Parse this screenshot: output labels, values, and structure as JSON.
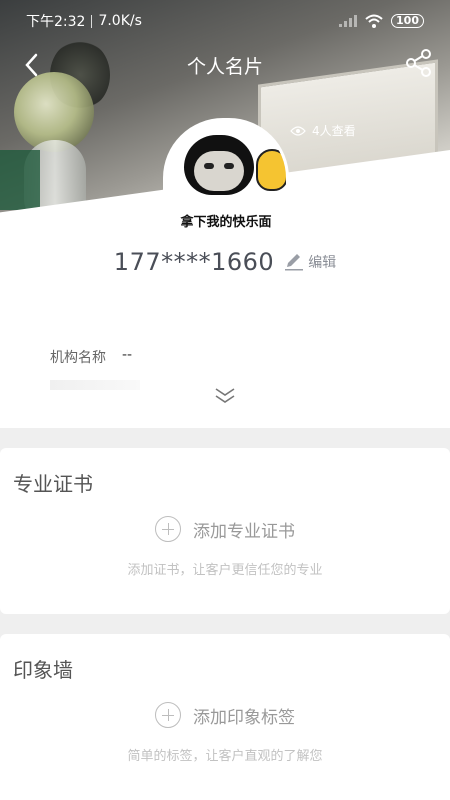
{
  "status_bar": {
    "time": "下午2:32",
    "speed": "7.0K/s",
    "battery": "100"
  },
  "nav": {
    "title": "个人名片"
  },
  "profile": {
    "views": "4人查看",
    "avatar_caption": "拿下我的快乐面",
    "phone": "177****1660",
    "edit_label": "编辑",
    "org_label": "机构名称",
    "org_value": "--"
  },
  "certificates": {
    "title": "专业证书",
    "add_label": "添加专业证书",
    "hint": "添加证书，让客户更信任您的专业"
  },
  "impression": {
    "title": "印象墙",
    "add_label": "添加印象标签",
    "hint": "简单的标签，让客户直观的了解您"
  }
}
